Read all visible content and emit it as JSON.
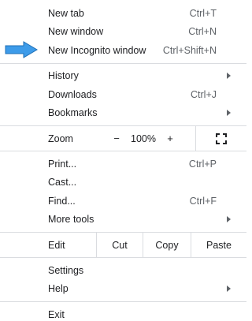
{
  "menu": {
    "group1": [
      {
        "label": "New tab",
        "shortcut": "Ctrl+T"
      },
      {
        "label": "New window",
        "shortcut": "Ctrl+N"
      },
      {
        "label": "New Incognito window",
        "shortcut": "Ctrl+Shift+N"
      }
    ],
    "group2": [
      {
        "label": "History",
        "shortcut": ""
      },
      {
        "label": "Downloads",
        "shortcut": "Ctrl+J"
      },
      {
        "label": "Bookmarks",
        "shortcut": ""
      }
    ],
    "zoom": {
      "label": "Zoom",
      "minus": "−",
      "value": "100%",
      "plus": "+"
    },
    "group3": [
      {
        "label": "Print...",
        "shortcut": "Ctrl+P"
      },
      {
        "label": "Cast...",
        "shortcut": ""
      },
      {
        "label": "Find...",
        "shortcut": "Ctrl+F"
      },
      {
        "label": "More tools",
        "shortcut": ""
      }
    ],
    "edit": {
      "label": "Edit",
      "cut": "Cut",
      "copy": "Copy",
      "paste": "Paste"
    },
    "group4": [
      {
        "label": "Settings",
        "shortcut": ""
      },
      {
        "label": "Help",
        "shortcut": ""
      }
    ],
    "group5": [
      {
        "label": "Exit",
        "shortcut": ""
      }
    ]
  },
  "colors": {
    "arrow": "#3d9be9",
    "arrow_stroke": "#1f6fb5",
    "divider": "#dadce0"
  },
  "icons": {
    "pointer": "blue-arrow-pointer-icon",
    "submenu": "submenu-arrow-icon",
    "fullscreen": "fullscreen-icon"
  }
}
